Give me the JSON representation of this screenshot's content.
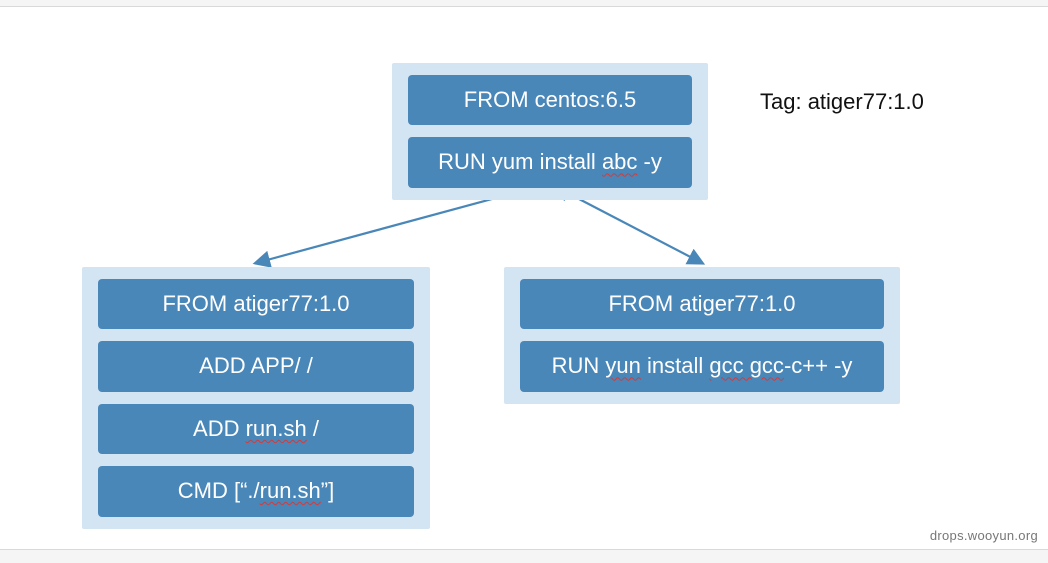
{
  "tag_label": "Tag: atiger77:1.0",
  "watermark": "drops.wooyun.org",
  "top": {
    "lines": [
      {
        "plain": "FROM  centos:6.5"
      },
      {
        "pre": "RUN yum install ",
        "squig": "abc",
        "post": " -y"
      }
    ]
  },
  "left": {
    "lines": [
      {
        "plain": "FROM atiger77:1.0"
      },
      {
        "plain": "ADD APP/  /"
      },
      {
        "pre": "ADD ",
        "squig": "run.sh",
        "post": "  /"
      },
      {
        "pre": "CMD [“./",
        "squig": "run.sh",
        "post": "”]"
      }
    ]
  },
  "right": {
    "lines": [
      {
        "plain": "FROM atiger77:1.0"
      },
      {
        "pre": "RUN ",
        "squig": "yun",
        "mid": " install ",
        "squig2": "gcc gcc",
        "post": "-c++ -y"
      }
    ]
  }
}
